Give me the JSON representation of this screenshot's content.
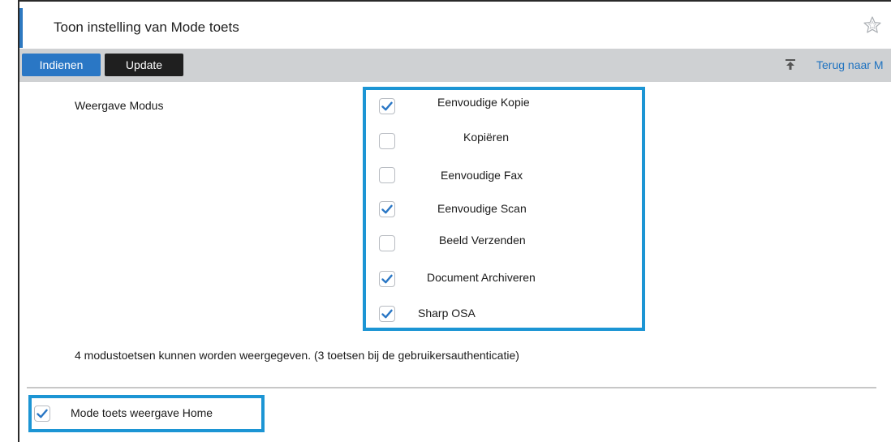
{
  "page": {
    "title": "Toon instelling van Mode toets"
  },
  "toolbar": {
    "submit_label": "Indienen",
    "update_label": "Update",
    "back_link": "Terug naar M",
    "back_icon": "back-to-top-icon"
  },
  "display_mode": {
    "label": "Weergave Modus",
    "options": [
      {
        "label": "Eenvoudige Kopie",
        "checked": true
      },
      {
        "label": "Kopiëren",
        "checked": false
      },
      {
        "label": "Eenvoudige Fax",
        "checked": false
      },
      {
        "label": "Eenvoudige Scan",
        "checked": true
      },
      {
        "label": "Beeld Verzenden",
        "checked": false
      },
      {
        "label": "Document Archiveren",
        "checked": true
      },
      {
        "label": "Sharp OSA",
        "checked": true
      }
    ],
    "info": "4 modustoetsen kunnen worden weergegeven. (3 toetsen bij de gebruikersauthenticatie)"
  },
  "home": {
    "label": "Mode toets weergave Home",
    "checked": true
  },
  "colors": {
    "accent_blue": "#2a77c5",
    "highlight_border": "#1c95d4",
    "toolbar_bg": "#cfd1d3",
    "check_color": "#2a77c5"
  }
}
